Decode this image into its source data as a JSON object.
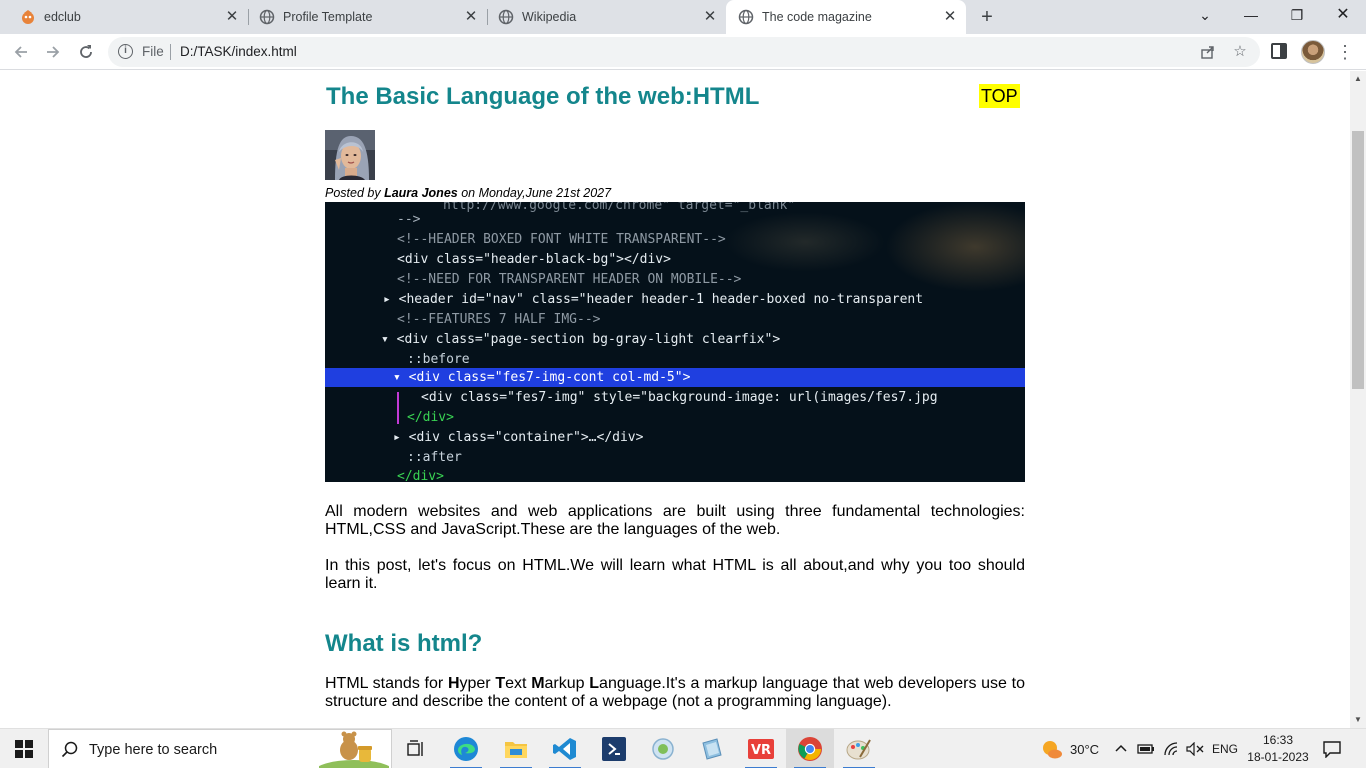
{
  "browser": {
    "tabs": [
      {
        "title": "edclub",
        "icon": "edclub-icon",
        "active": false
      },
      {
        "title": "Profile Template",
        "icon": "globe-icon",
        "active": false
      },
      {
        "title": "Wikipedia",
        "icon": "globe-icon",
        "active": false
      },
      {
        "title": "The code magazine",
        "icon": "globe-icon",
        "active": true
      }
    ],
    "address": {
      "scheme_label": "File",
      "url": "D:/TASK/index.html"
    }
  },
  "article": {
    "title": "The Basic Language of the web:HTML",
    "top_link": "TOP",
    "byline": {
      "prefix": "Posted by ",
      "author": "Laura Jones",
      "suffix": " on Monday,June 21st 2027"
    },
    "hero_code_lines": [
      "http://www.google.com/chrome\" target=\"_blank\"",
      "-->",
      "<!--HEADER BOXED FONT WHITE TRANSPARENT-->",
      "<div class=\"header-black-bg\"></div>",
      "<!--NEED FOR TRANSPARENT HEADER ON MOBILE-->",
      "<header id=\"nav\" class=\"header header-1 header-boxed no-transparent",
      "<!--FEATURES 7 HALF IMG-->",
      "<div class=\"page-section bg-gray-light clearfix\">",
      "::before",
      "<div class=\"fes7-img-cont col-md-5\">",
      "<div class=\"fes7-img\" style=\"background-image: url(images/fes7.jpg",
      "</div>",
      "<div class=\"container\">…</div>",
      "::after",
      "</div>"
    ],
    "paragraph1": "All modern websites and web applications are built using three fundamental technologies: HTML,CSS and JavaScript.These are the languages of the web.",
    "paragraph2": "In this post, let's focus on HTML.We will learn what HTML is all about,and why you too should learn it.",
    "section_heading": "What is html?",
    "paragraph3": {
      "prefix": "HTML stands for ",
      "acronym": [
        {
          "letter": "H",
          "rest": "yper "
        },
        {
          "letter": "T",
          "rest": "ext "
        },
        {
          "letter": "M",
          "rest": "arkup "
        },
        {
          "letter": "L",
          "rest": "anguage"
        }
      ],
      "suffix": ".It's a markup language that web developers use to structure and describe the content of a webpage (not a programming language)."
    }
  },
  "taskbar": {
    "search_placeholder": "Type here to search",
    "apps": [
      "task-view-icon",
      "edge-icon",
      "file-explorer-icon",
      "vscode-icon",
      "powershell-icon",
      "app-icon",
      "app-icon",
      "app-icon",
      "chrome-icon",
      "paint-icon"
    ],
    "weather": "30°C",
    "language": "ENG",
    "time": "16:33",
    "date": "18-01-2023"
  },
  "colors": {
    "heading": "#14868c",
    "top_link_bg": "#ffff00",
    "code_highlight": "#1f3fe0",
    "tag_green": "#39d353"
  }
}
